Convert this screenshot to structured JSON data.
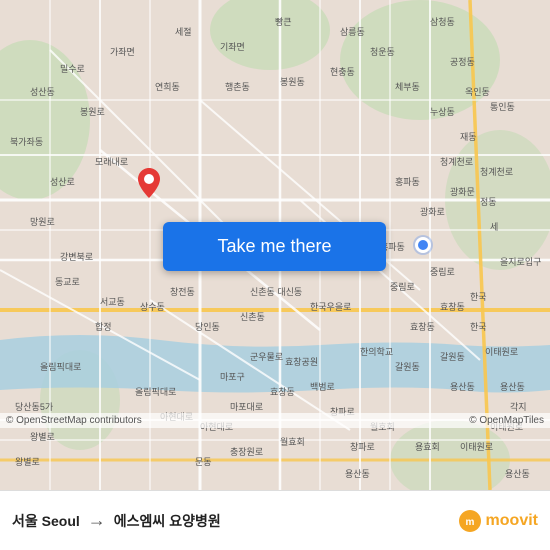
{
  "map": {
    "background_color": "#e8e0d8",
    "button_label": "Take me there",
    "attribution_left": "© OpenStreetMap contributors",
    "attribution_right": "© OpenMapTiles"
  },
  "bottom_bar": {
    "from": "서울 Seoul",
    "arrow": "→",
    "to": "에스엠씨 요양병원",
    "logo": "moovit"
  },
  "pin": {
    "color": "#e53935"
  },
  "blue_dot": {
    "color": "#4285f4"
  }
}
